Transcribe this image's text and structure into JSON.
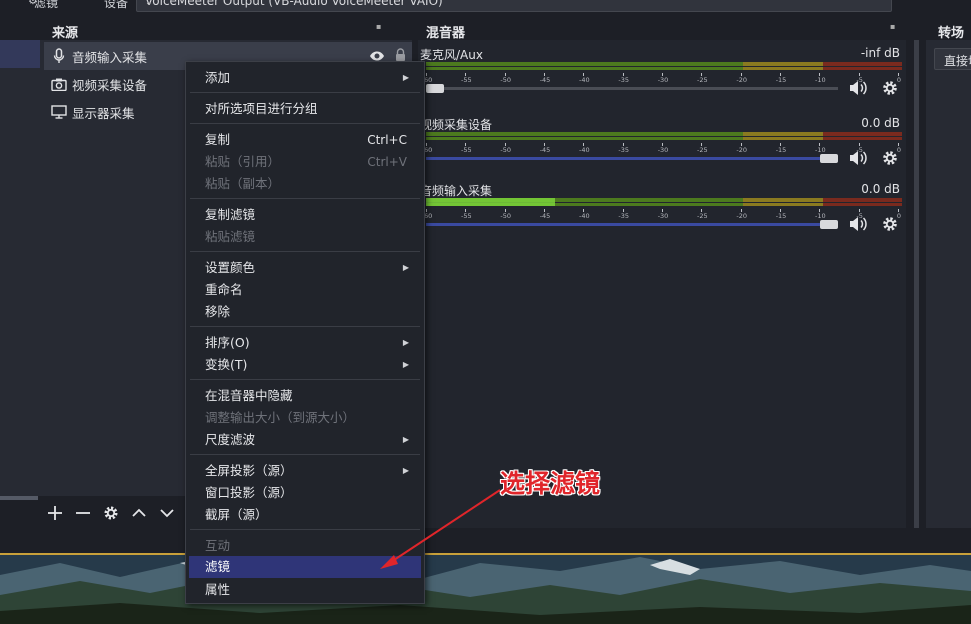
{
  "topbar": {
    "filters_label": "滤镜",
    "device_label": "设备",
    "device_value": "VoiceMeeter Output (VB-Audio VoiceMeeter VAIO)"
  },
  "docks": {
    "sources_title": "来源",
    "mixer_title": "混音器",
    "transitions_title": "转场特"
  },
  "sources": [
    {
      "label": "音频输入采集",
      "icon": "microphone-icon"
    },
    {
      "label": "视频采集设备",
      "icon": "camera-icon"
    },
    {
      "label": "显示器采集",
      "icon": "monitor-icon"
    }
  ],
  "mixer": {
    "scale_labels": [
      "-60",
      "-55",
      "-50",
      "-45",
      "-40",
      "-35",
      "-30",
      "-25",
      "-20",
      "-15",
      "-10",
      "-5",
      "0"
    ],
    "channels": [
      {
        "name": "麦克风/Aux",
        "db": "-inf dB",
        "level": 0.0,
        "volume": 0.0
      },
      {
        "name": "视频采集设备",
        "db": "0.0 dB",
        "level": 0.0,
        "volume": 1.0
      },
      {
        "name": "音频输入采集",
        "db": "0.0 dB",
        "level": 0.27,
        "volume": 1.0
      }
    ]
  },
  "transitions": {
    "selected": "直接切"
  },
  "context_menu": {
    "items": [
      {
        "label": "添加",
        "submenu": true
      },
      {
        "label": "对所选项目进行分组"
      },
      {
        "label": "复制",
        "shortcut": "Ctrl+C"
      },
      {
        "label": "粘贴（引用）",
        "shortcut": "Ctrl+V",
        "disabled": true
      },
      {
        "label": "粘贴（副本）",
        "disabled": true
      },
      {
        "label": "复制滤镜"
      },
      {
        "label": "粘贴滤镜",
        "disabled": true
      },
      {
        "label": "设置颜色",
        "submenu": true
      },
      {
        "label": "重命名"
      },
      {
        "label": "移除"
      },
      {
        "label": "排序(O)",
        "submenu": true
      },
      {
        "label": "变换(T)",
        "submenu": true
      },
      {
        "label": "在混音器中隐藏"
      },
      {
        "label": "调整输出大小（到源大小）",
        "disabled": true
      },
      {
        "label": "尺度滤波",
        "submenu": true
      },
      {
        "label": "全屏投影（源）",
        "submenu": true
      },
      {
        "label": "窗口投影（源）"
      },
      {
        "label": "截屏（源）"
      },
      {
        "label": "互动",
        "disabled": true
      },
      {
        "label": "滤镜",
        "active": true
      },
      {
        "label": "属性"
      }
    ]
  },
  "annotation": {
    "text": "选择滤镜",
    "color": "#e0252a"
  },
  "colors": {
    "meter_green": "#4c7a1e",
    "meter_yellow": "#8a7a20",
    "meter_red": "#7a2a1e",
    "level_green": "#7ad23a",
    "slider_blue": "#3a4aa0",
    "menu_active": "#2f3578"
  }
}
